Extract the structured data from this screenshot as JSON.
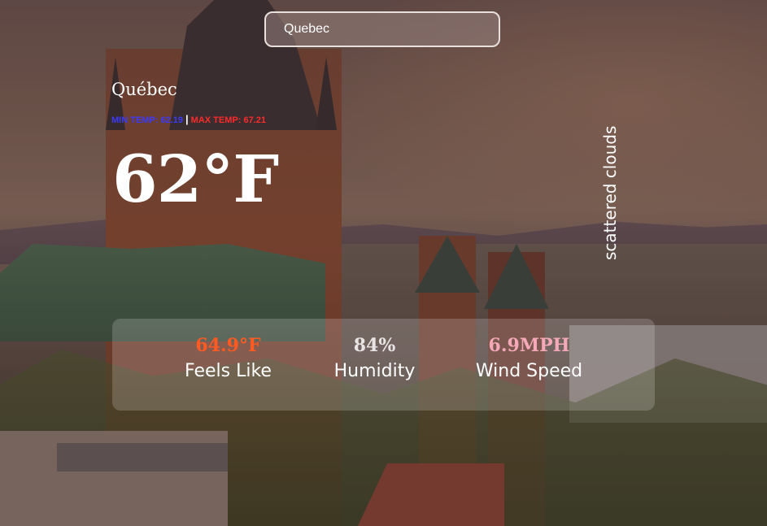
{
  "search": {
    "value": "Quebec",
    "placeholder": ""
  },
  "weather": {
    "city": "Québec",
    "min_label": "MIN TEMP: 62.19",
    "separator": "|",
    "max_label": "MAX TEMP: 67.21",
    "temperature": "62°F",
    "description": "scattered clouds"
  },
  "stats": {
    "feels_like": {
      "value": "64.9°F",
      "label": "Feels Like"
    },
    "humidity": {
      "value": "84%",
      "label": "Humidity"
    },
    "wind": {
      "value": "6.9MPH",
      "label": "Wind Speed"
    }
  },
  "colors": {
    "min_temp": "#3b3bff",
    "max_temp": "#ff2a2a",
    "feels_like": "#ff5a22",
    "wind": "#f4a8b8"
  }
}
